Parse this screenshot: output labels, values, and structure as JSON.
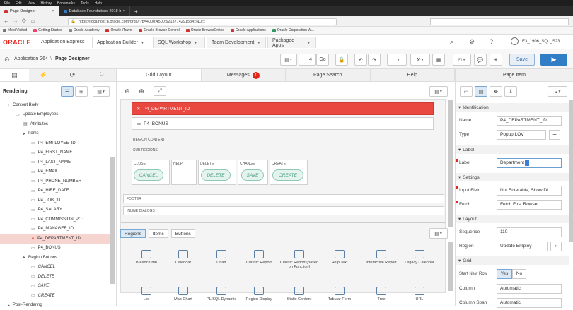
{
  "browser": {
    "menu": [
      "File",
      "Edit",
      "View",
      "History",
      "Bookmarks",
      "Tools",
      "Help"
    ],
    "tabs": [
      {
        "label": "Page Designer",
        "active": true
      },
      {
        "label": "Database Foundations 2018 Instructi...",
        "active": false
      }
    ],
    "url": "https://localhost:8.oracle.com/ords/f?p=4000:4500:6213774291584::NO:::",
    "bookmarks": [
      "Most Visited",
      "Getting Started",
      "Oracle Academy",
      "Oracle iTravel",
      "Oracle Browse Control",
      "Oracle BrowseOnline",
      "Oracle Applications",
      "Oracle Corporation W..."
    ]
  },
  "apex": {
    "brand": "ORACLE",
    "product": "Application Express",
    "nav_tabs": [
      "Application Builder",
      "SQL Workshop",
      "Team Development",
      "Packaged Apps"
    ],
    "user": "E3_1906_SQL_S23"
  },
  "toolbar": {
    "application": "Application 264",
    "page_designer": "Page Designer",
    "page_number": "4",
    "go_label": "Go",
    "save_label": "Save"
  },
  "left": {
    "heading": "Rendering",
    "tree": [
      {
        "label": "Content Body",
        "indent": 1,
        "icon": "folder"
      },
      {
        "label": "Update Employees",
        "indent": 2,
        "icon": "region"
      },
      {
        "label": "Attributes",
        "indent": 3,
        "icon": "attr"
      },
      {
        "label": "Items",
        "indent": 3,
        "icon": "folder"
      },
      {
        "label": "P4_EMPLOYEE_ID",
        "indent": 4,
        "icon": "item"
      },
      {
        "label": "P4_FIRST_NAME",
        "indent": 4,
        "icon": "item"
      },
      {
        "label": "P4_LAST_NAME",
        "indent": 4,
        "icon": "item"
      },
      {
        "label": "P4_EMAIL",
        "indent": 4,
        "icon": "item"
      },
      {
        "label": "P4_PHONE_NUMBER",
        "indent": 4,
        "icon": "item"
      },
      {
        "label": "P4_HIRE_DATE",
        "indent": 4,
        "icon": "item"
      },
      {
        "label": "P4_JOB_ID",
        "indent": 4,
        "icon": "item"
      },
      {
        "label": "P4_SALARY",
        "indent": 4,
        "icon": "item"
      },
      {
        "label": "P4_COMMISSION_PCT",
        "indent": 4,
        "icon": "item"
      },
      {
        "label": "P4_MANAGER_ID",
        "indent": 4,
        "icon": "item"
      },
      {
        "label": "P4_DEPARTMENT_ID",
        "indent": 4,
        "icon": "error",
        "selected": true
      },
      {
        "label": "P4_BONUS",
        "indent": 4,
        "icon": "item"
      },
      {
        "label": "Region Buttons",
        "indent": 3,
        "icon": "folder"
      },
      {
        "label": "CANCEL",
        "indent": 4,
        "icon": "button"
      },
      {
        "label": "DELETE",
        "indent": 4,
        "icon": "button"
      },
      {
        "label": "SAVE",
        "indent": 4,
        "icon": "button"
      },
      {
        "label": "CREATE",
        "indent": 4,
        "icon": "button"
      },
      {
        "label": "Post-Rendering",
        "indent": 1,
        "icon": "folder"
      }
    ]
  },
  "center": {
    "tabs": [
      "Grid Layout",
      "Messages",
      "Page Search",
      "Help"
    ],
    "messages_count": "1",
    "selected_item": "P4_DEPARTMENT_ID",
    "bonus_item": "P4_BONUS",
    "region_content": "REGION CONTENT",
    "sub_regions": "SUB REGIONS",
    "button_positions": [
      "CLOSE",
      "HELP",
      "DELETE",
      "CHANGE",
      "CREATE"
    ],
    "buttons": [
      "CANCEL",
      "DELETE",
      "SAVE",
      "CREATE"
    ],
    "footer": "FOOTER",
    "inline_dialogs": "INLINE DIALOGS",
    "palette_tabs": [
      "Regions",
      "Items",
      "Buttons"
    ],
    "palette": [
      "Breadcrumb",
      "Calendar",
      "Chart",
      "Classic Report",
      "Classic Report (based on Function)",
      "Help Text",
      "Interactive Report",
      "Legacy Calendar",
      "List",
      "Map Chart",
      "PL/SQL Dynamic",
      "Region Display",
      "Static Content",
      "Tabular Form",
      "Tree",
      "URL"
    ]
  },
  "right": {
    "title": "Page Item",
    "identification": "Identification",
    "name_label": "Name",
    "name_value": "P4_DEPARTMENT_ID",
    "type_label": "Type",
    "type_value": "Popup LOV",
    "label_section": "Label",
    "label_label": "Label",
    "label_value": "Department",
    "settings": "Settings",
    "input_field_label": "Input Field",
    "input_field_value": "Not Enterable, Show Di",
    "fetch_label": "Fetch",
    "fetch_value": "Fetch First Rowset",
    "layout": "Layout",
    "sequence_label": "Sequence",
    "sequence_value": "110",
    "region_label": "Region",
    "region_value": "Update Employ",
    "grid": "Grid",
    "start_new_row_label": "Start New Row",
    "yes": "Yes",
    "no": "No",
    "column_label": "Column",
    "column_value": "Automatic",
    "column_span_label": "Column Span",
    "column_span_value": "Automatic"
  },
  "colors": {
    "oracle_red": "#e3241b",
    "save_blue": "#2f7ec6",
    "error_bg": "#e8483f"
  }
}
